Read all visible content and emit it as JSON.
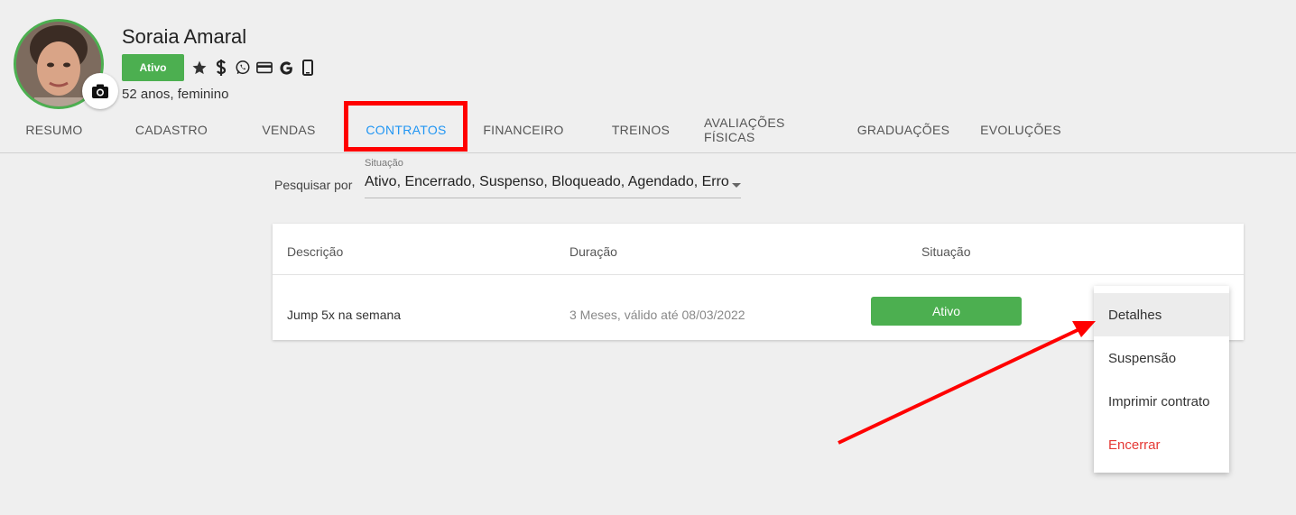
{
  "client": {
    "name": "Soraia Amaral",
    "status": "Ativo",
    "info": "52 anos, feminino",
    "icons": [
      "star-icon",
      "dollar-icon",
      "whatsapp-icon",
      "credit-card-icon",
      "google-icon",
      "mobile-phone-icon"
    ]
  },
  "tabs": [
    {
      "label": "RESUMO"
    },
    {
      "label": "CADASTRO"
    },
    {
      "label": "VENDAS"
    },
    {
      "label": "CONTRATOS",
      "active": true
    },
    {
      "label": "FINANCEIRO"
    },
    {
      "label": "TREINOS"
    },
    {
      "label": "AVALIAÇÕES FÍSICAS"
    },
    {
      "label": "GRADUAÇÕES"
    },
    {
      "label": "EVOLUÇÕES"
    }
  ],
  "filter": {
    "label": "Pesquisar por",
    "caption": "Situação",
    "value": "Ativo, Encerrado, Suspenso, Bloqueado, Agendado, Erro"
  },
  "table": {
    "headers": [
      "Descrição",
      "Duração",
      "Situação"
    ],
    "rows": [
      {
        "descricao": "Jump 5x na semana",
        "duracao": "3 Meses, válido até 08/03/2022",
        "situacao": "Ativo"
      }
    ]
  },
  "menu": {
    "items": [
      "Detalhes",
      "Suspensão",
      "Imprimir contrato",
      "Encerrar"
    ]
  },
  "colors": {
    "accent": "#2196f3",
    "success": "#4caf50",
    "danger": "#e53935",
    "annotation": "#ff0000"
  }
}
